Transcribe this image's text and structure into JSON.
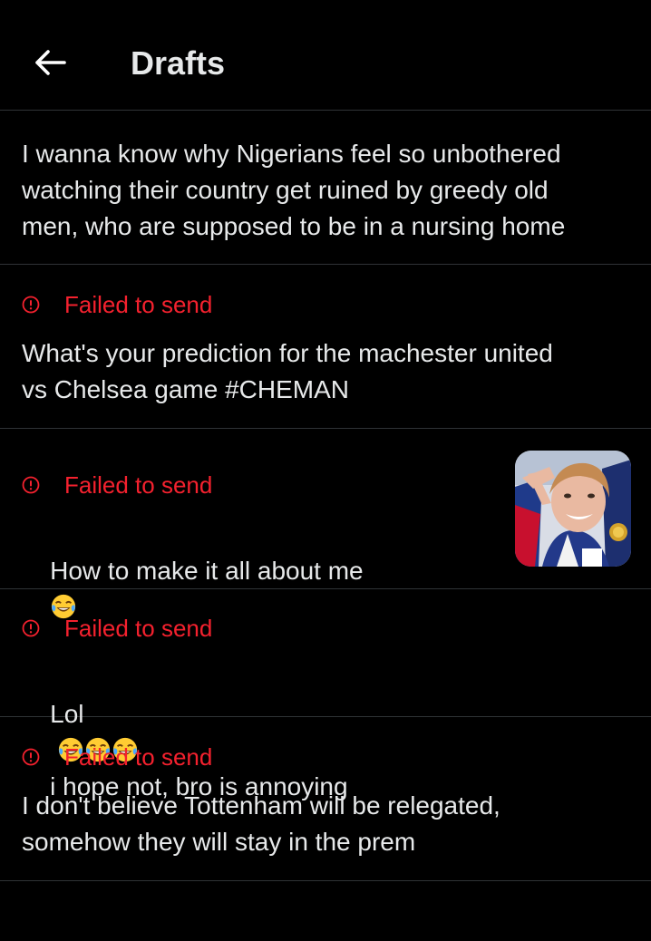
{
  "header": {
    "title": "Drafts",
    "back_icon": "arrow-left-icon"
  },
  "colors": {
    "background": "#000000",
    "text": "#e7e9ea",
    "error": "#f4212e",
    "divider": "#2f3336"
  },
  "drafts": [
    {
      "text": "I wanna know why Nigerians feel so unbothered\nwatching their country get ruined by greedy old\nmen, who are supposed to be in a nursing home",
      "failed": false
    },
    {
      "status": "Failed to send",
      "text": "What's your prediction for the machester united\nvs Chelsea game #CHEMAN",
      "failed": true
    },
    {
      "status": "Failed to send",
      "text": "How to make it all about me",
      "emoji": "tears-of-joy-emoji",
      "has_media": true,
      "failed": true
    },
    {
      "status": "Failed to send",
      "text_prefix": "Lol",
      "text_suffix": "i hope not, bro is annoying",
      "emoji_count": 3,
      "failed": true
    },
    {
      "status": "Failed to send",
      "text": "I don't believe Tottenham will be relegated,\nsomehow they will stay in the prem",
      "failed": true
    }
  ]
}
